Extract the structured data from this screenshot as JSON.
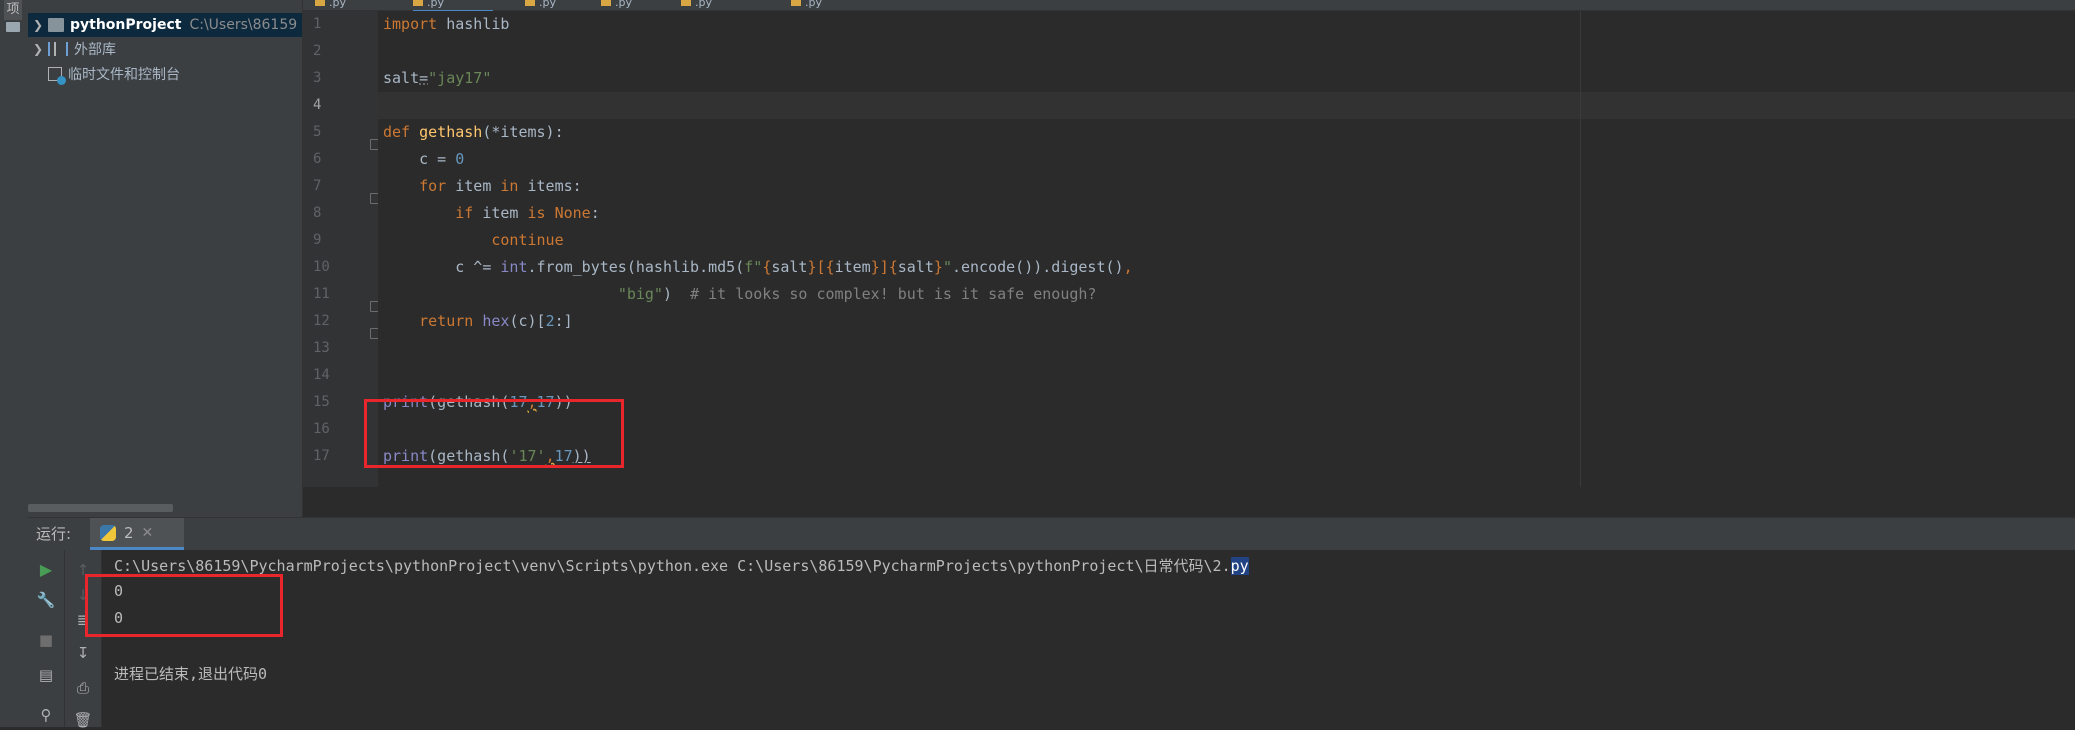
{
  "project": {
    "root_name": "pythonProject",
    "root_path": "C:\\Users\\86159",
    "items": [
      {
        "label": "外部库"
      },
      {
        "label": "临时文件和控制台"
      }
    ]
  },
  "tool_strip_label": "项",
  "editor": {
    "tabs": [
      {
        "label": ".py"
      },
      {
        "label": ".py"
      },
      {
        "label": ".py"
      },
      {
        "label": ".py"
      },
      {
        "label": ".py"
      },
      {
        "label": ".py"
      }
    ],
    "current_line": 4,
    "line_numbers": [
      "1",
      "2",
      "3",
      "4",
      "5",
      "6",
      "7",
      "8",
      "9",
      "10",
      "11",
      "12",
      "13",
      "14",
      "15",
      "16",
      "17"
    ],
    "code": {
      "l1_kw": "import",
      "l1_rest": " hashlib",
      "l3_var": "salt",
      "l3_eq": "=",
      "l3_str": "\"jay17\"",
      "l5_kw": "def",
      "l5_fn": "gethash",
      "l5_rest": "(*items):",
      "l6_pre": "    c = ",
      "l6_num": "0",
      "l7_kw": "for",
      "l7_mid": " item ",
      "l7_kw2": "in",
      "l7_rest": " items:",
      "l8_kw": "if",
      "l8_mid": " item ",
      "l8_kw2": "is",
      "l8_kw3": "None",
      "l8_rest": ":",
      "l9_kw": "continue",
      "l10_a": "c ^= ",
      "l10_bi": "int",
      "l10_b": ".from_bytes(hashlib.md5(",
      "l10_f": "f\"",
      "l10_s1": "{",
      "l10_v1": "salt",
      "l10_s2": "}[{",
      "l10_v2": "item",
      "l10_s3": "}]{",
      "l10_v3": "salt",
      "l10_s4": "}",
      "l10_q": "\"",
      "l10_c": ".encode()).digest()",
      "l10_comma": ",",
      "l11_str": "\"big\"",
      "l11_mid": ")  ",
      "l11_cm": "# it looks so complex! but is it safe enough?",
      "l12_kw": "return",
      "l12_bi": "hex",
      "l12_a": "(c)[",
      "l12_num": "2",
      "l12_b": ":]",
      "l15_bi": "print",
      "l15_a": "(gethash(",
      "l15_n1": "17",
      "l15_comma": ",",
      "l15_n2": "17",
      "l15_b": "))",
      "l17_bi": "print",
      "l17_a": "(gethash(",
      "l17_str": "'17'",
      "l17_comma": ",",
      "l17_n2": "17",
      "l17_b": "))"
    }
  },
  "run": {
    "label": "运行:",
    "tab_label": "2",
    "command": "C:\\Users\\86159\\PycharmProjects\\pythonProject\\venv\\Scripts\\python.exe C:\\Users\\86159\\PycharmProjects\\pythonProject\\日常代码\\2.",
    "command_tail": "py",
    "output": [
      "0",
      "0"
    ],
    "exit_message": "进程已结束,退出代码0"
  }
}
